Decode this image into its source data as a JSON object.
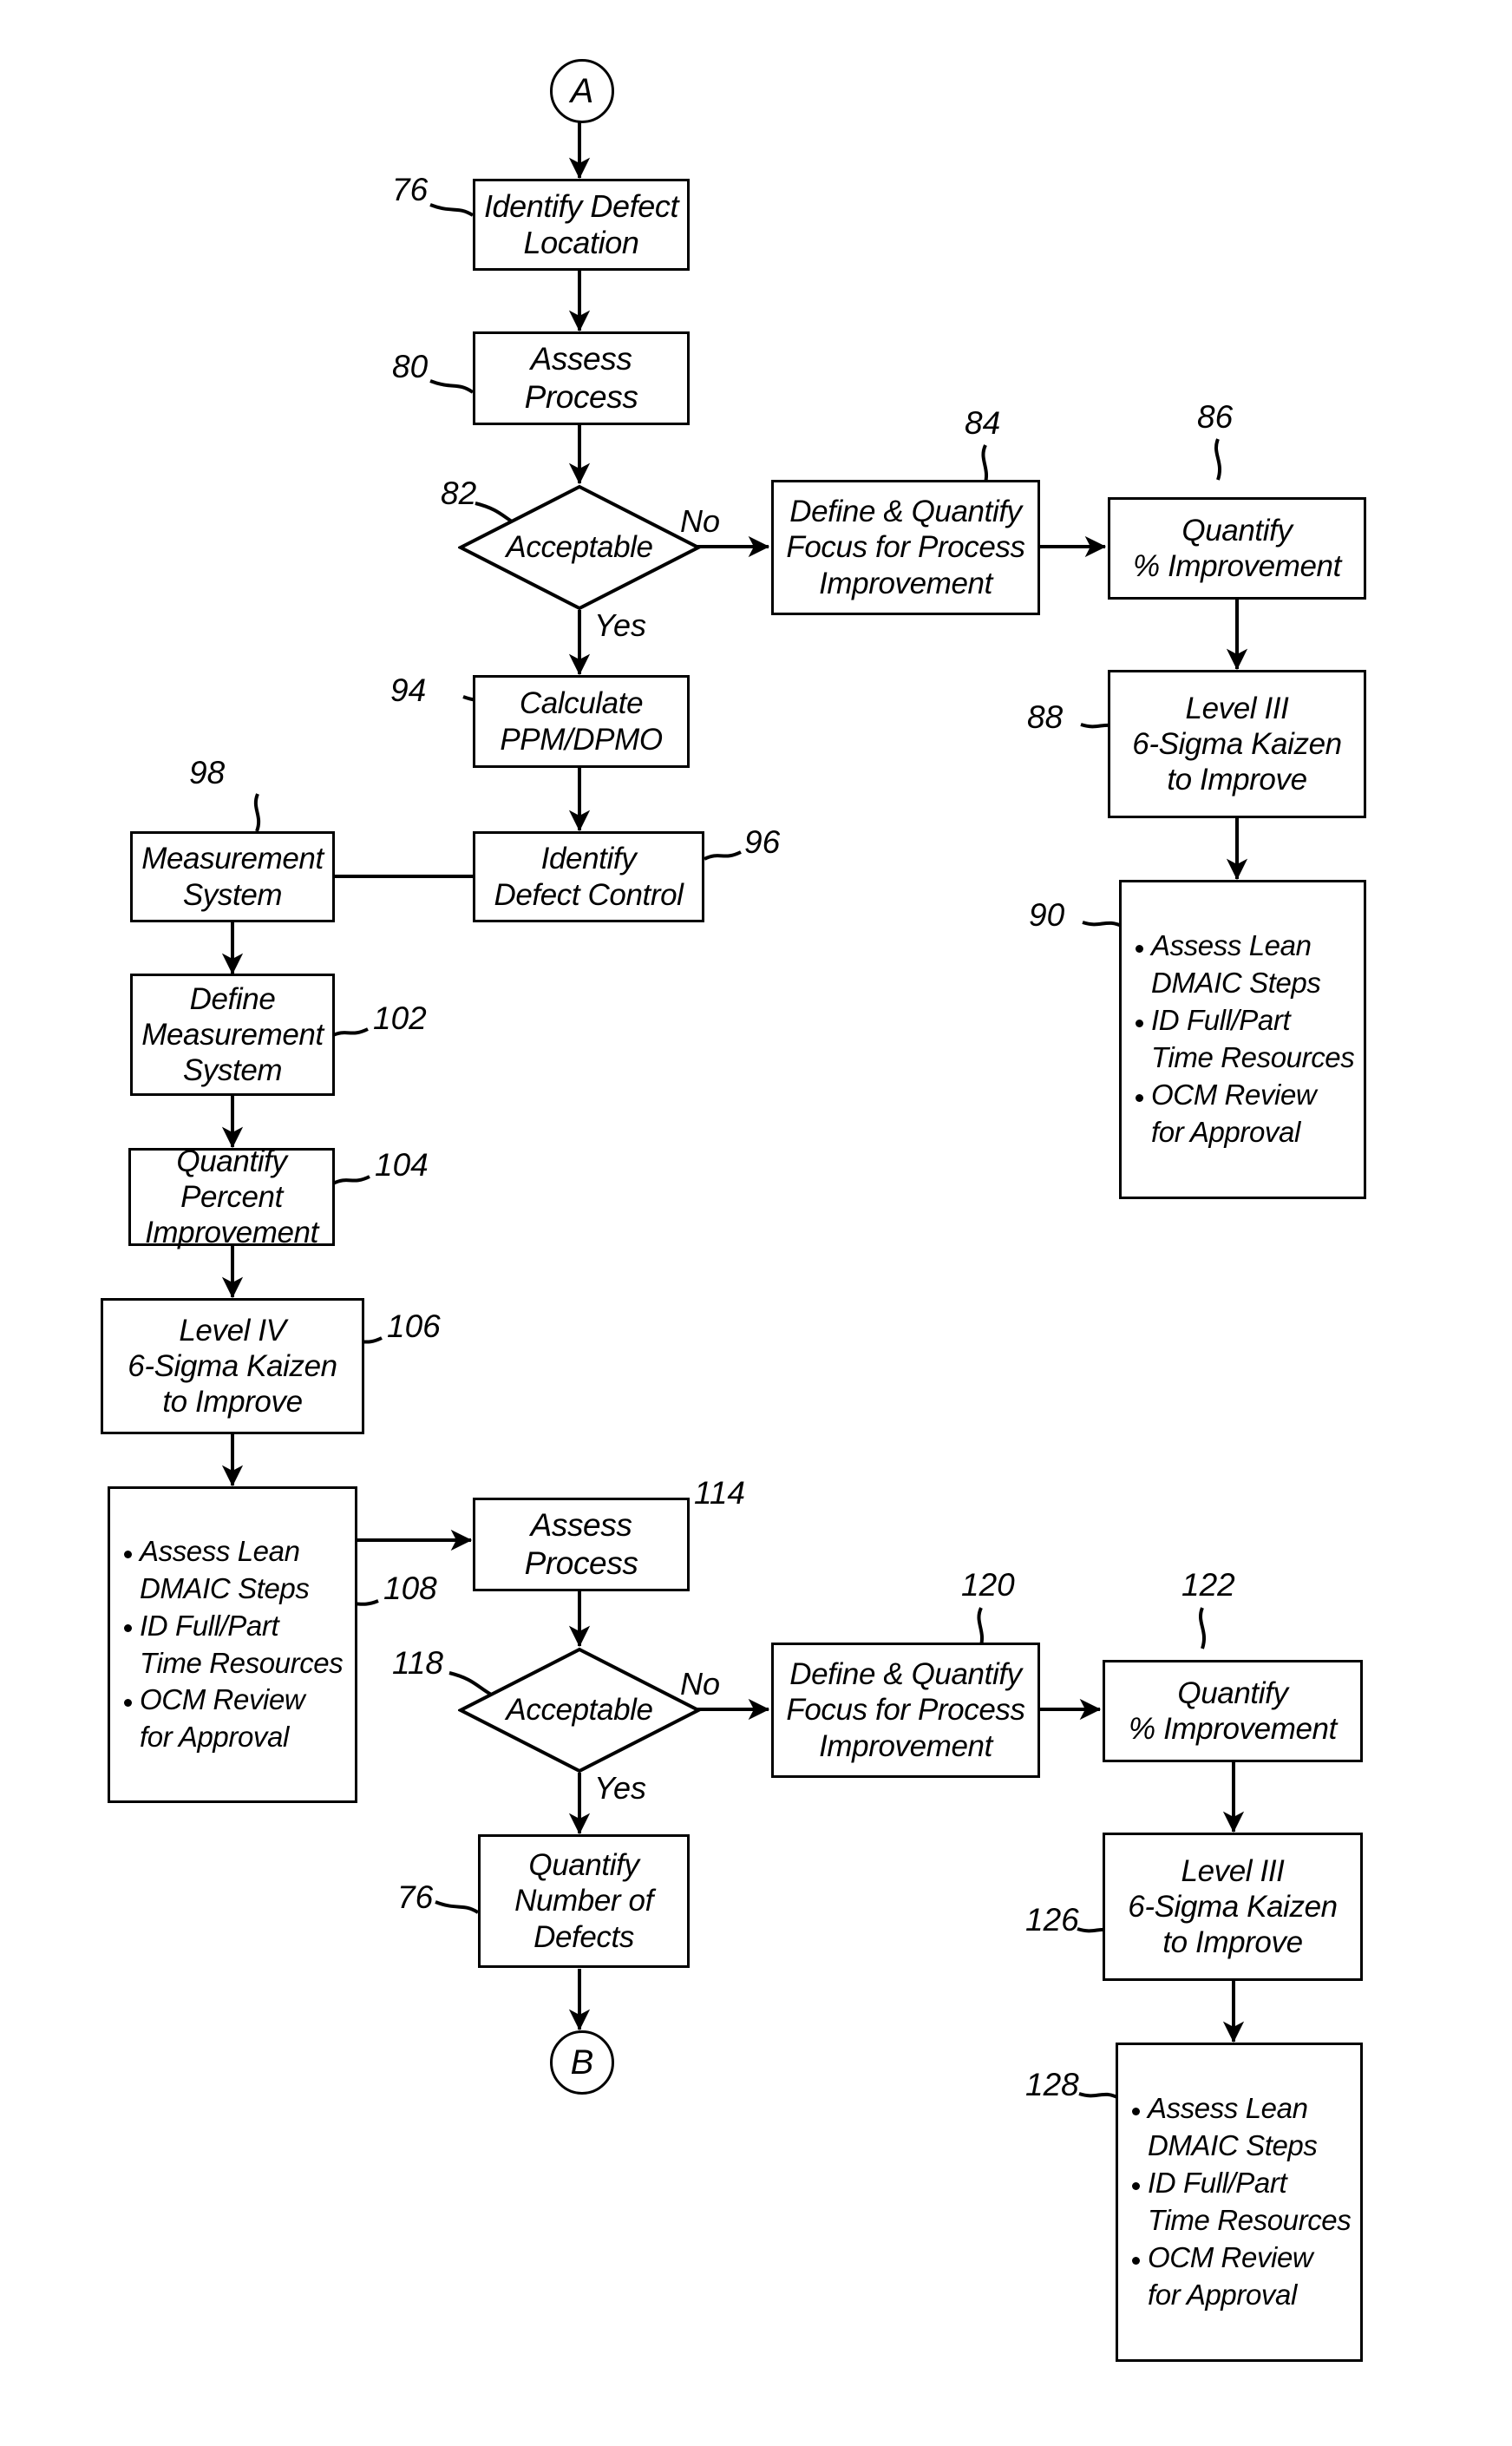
{
  "figure": {
    "type": "patent-flowchart",
    "orientation": "portrait",
    "background_color": "#ffffff",
    "line_color": "#000000"
  },
  "connectors": {
    "a": {
      "label": "A"
    },
    "b": {
      "label": "B"
    }
  },
  "edge_labels": {
    "no_1": "No",
    "yes_1": "Yes",
    "no_2": "No",
    "yes_2": "Yes"
  },
  "nodes": {
    "identify_defect_location": {
      "text": "Identify Defect\nLocation",
      "ref": "76"
    },
    "assess_process_1": {
      "text": "Assess\nProcess",
      "ref": "80"
    },
    "acceptable_1": {
      "text": "Acceptable",
      "ref": "82"
    },
    "define_quantify_1": {
      "text": "Define & Quantify\nFocus for Process\nImprovement",
      "ref": "84"
    },
    "quantify_pct_1": {
      "text": "Quantify\n% Improvement",
      "ref": "86"
    },
    "level3_kaizen_1": {
      "text": "Level III\n6-Sigma Kaizen\nto Improve",
      "ref": "88"
    },
    "assess_lean_1": {
      "ref": "90",
      "bullets": [
        "Assess Lean\nDMAIC Steps",
        "ID Full/Part\nTime Resources",
        "OCM Review\nfor Approval"
      ]
    },
    "calculate_ppm": {
      "text": "Calculate\nPPM/DPMO",
      "ref": "94"
    },
    "identify_defect_control": {
      "text": "Identify\nDefect Control",
      "ref": "96"
    },
    "measurement_system": {
      "text": "Measurement\nSystem",
      "ref": "98"
    },
    "define_measurement_system": {
      "text": "Define\nMeasurement\nSystem",
      "ref": "102"
    },
    "quantify_percent_improvement": {
      "text": "Quantify\nPercent\nImprovement",
      "ref": "104"
    },
    "level4_kaizen": {
      "text": "Level IV\n6-Sigma Kaizen\nto Improve",
      "ref": "106"
    },
    "assess_lean_2": {
      "ref": "108",
      "bullets": [
        "Assess Lean\nDMAIC Steps",
        "ID Full/Part\nTime Resources",
        "OCM Review\nfor Approval"
      ]
    },
    "assess_process_2": {
      "text": "Assess\nProcess",
      "ref": "114"
    },
    "acceptable_2": {
      "text": "Acceptable",
      "ref": "118"
    },
    "define_quantify_2": {
      "text": "Define & Quantify\nFocus for Process\nImprovement",
      "ref": "120"
    },
    "quantify_pct_2": {
      "text": "Quantify\n% Improvement",
      "ref": "122"
    },
    "level3_kaizen_2": {
      "text": "Level III\n6-Sigma Kaizen\nto Improve",
      "ref": "126"
    },
    "assess_lean_3": {
      "ref": "128",
      "bullets": [
        "Assess Lean\nDMAIC Steps",
        "ID Full/Part\nTime Resources",
        "OCM Review\nfor Approval"
      ]
    },
    "quantify_number_defects": {
      "text": "Quantify\nNumber of\nDefects",
      "ref": "76"
    }
  }
}
